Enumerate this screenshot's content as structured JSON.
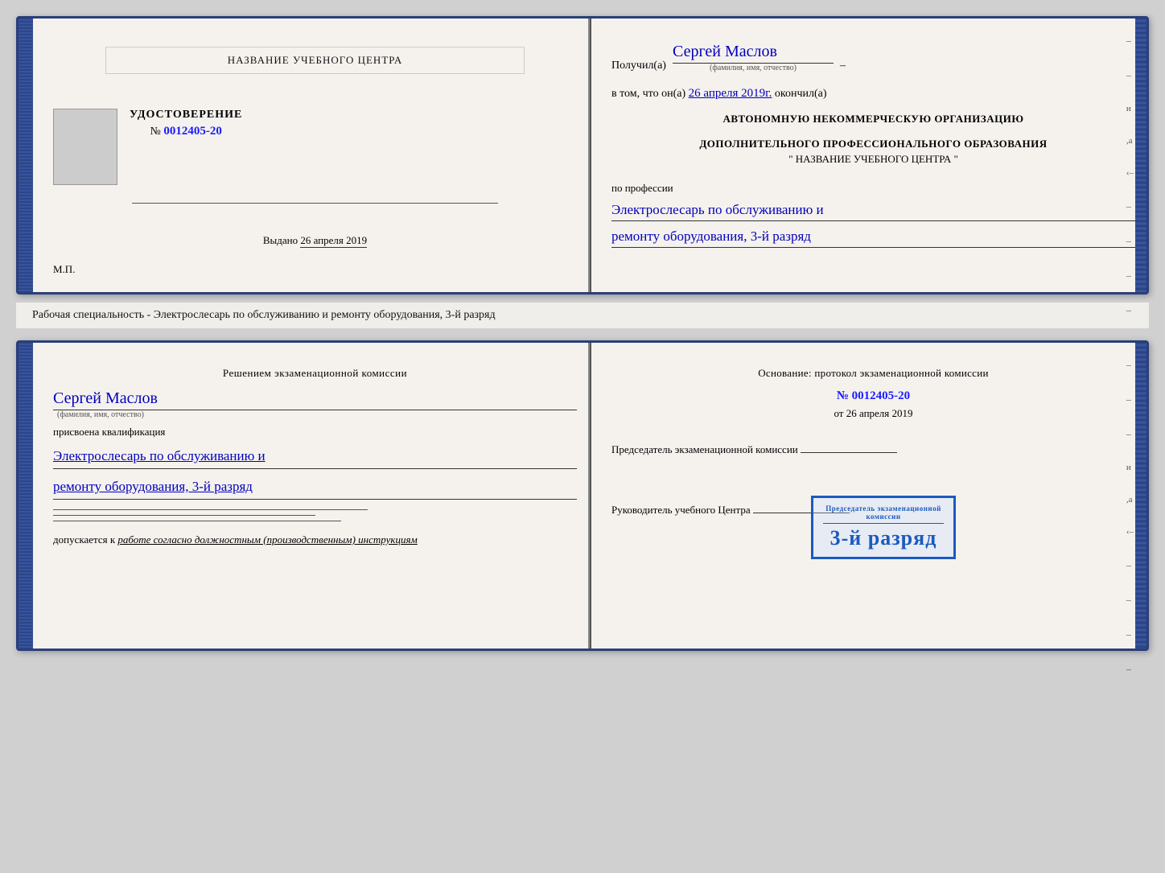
{
  "upper_cert": {
    "left": {
      "title": "НАЗВАНИЕ УЧЕБНОГО ЦЕНТРА",
      "section_label": "УДОСТОВЕРЕНИЕ",
      "number_prefix": "№",
      "number": "0012405-20",
      "vydano_label": "Выдано",
      "vydano_date": "26 апреля 2019",
      "mp_label": "М.П."
    },
    "right": {
      "poluchil_label": "Получил(а)",
      "poluchil_name": "Сергей Маслов",
      "fio_small": "(фамилия, имя, отчество)",
      "vtom_label": "в том, что он(а)",
      "vtom_date": "26 апреля 2019г.",
      "okончил_label": "окончил(а)",
      "org_line1": "АВТОНОМНУЮ НЕКОММЕРЧЕСКУЮ ОРГАНИЗАЦИЮ",
      "org_line2": "ДОПОЛНИТЕЛЬНОГО ПРОФЕССИОНАЛЬНОГО ОБРАЗОВАНИЯ",
      "org_quote": "\"   НАЗВАНИЕ УЧЕБНОГО ЦЕНТРА   \"",
      "po_professii_label": "по профессии",
      "profession1": "Электрослесарь по обслуживанию и",
      "profession2": "ремонту оборудования, 3-й разряд"
    }
  },
  "description": "Рабочая специальность - Электрослесарь по обслуживанию и ремонту оборудования, 3-й разряд",
  "lower_cert": {
    "left": {
      "resheniem_label": "Решением экзаменационной комиссии",
      "person_name": "Сергей Маслов",
      "fio_small": "(фамилия, имя, отчество)",
      "prisvoena_label": "присвоена квалификация",
      "qualification1": "Электрослесарь по обслуживанию и",
      "qualification2": "ремонту оборудования, 3-й разряд",
      "dopuskaetsya_label": "допускается к",
      "dopuskaetsya_text": "работе согласно должностным (производственным) инструкциям"
    },
    "right": {
      "osnovanie_label": "Основание: протокол экзаменационной комиссии",
      "number_prefix": "№",
      "number": "0012405-20",
      "ot_label": "от",
      "ot_date": "26 апреля 2019",
      "chairman_label": "Председатель экзаменационной комиссии",
      "rukov_label": "Руководитель учебного Центра"
    },
    "stamp": {
      "text": "3-й разряд"
    }
  }
}
